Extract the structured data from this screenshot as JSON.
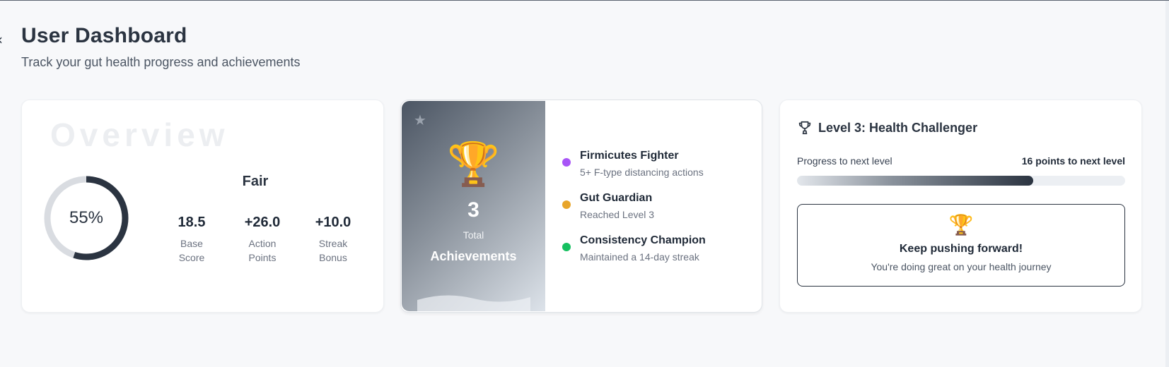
{
  "header": {
    "title": "User Dashboard",
    "subtitle": "Track your gut health progress and achievements"
  },
  "overview": {
    "watermark": "Overview",
    "score_percent": 55,
    "score_label": "55%",
    "status": "Fair",
    "stats": [
      {
        "value": "18.5",
        "label": "Base Score"
      },
      {
        "value": "+26.0",
        "label": "Action Points"
      },
      {
        "value": "+10.0",
        "label": "Streak Bonus"
      }
    ]
  },
  "achievements": {
    "count": "3",
    "total_label": "Total",
    "title": "Achievements",
    "items": [
      {
        "name": "Firmicutes Fighter",
        "description": "5+ F-type distancing actions",
        "color": "#a855f7"
      },
      {
        "name": "Gut Guardian",
        "description": "Reached Level 3",
        "color": "#e8a52a"
      },
      {
        "name": "Consistency Champion",
        "description": "Maintained a 14-day streak",
        "color": "#16c060"
      }
    ]
  },
  "level": {
    "title": "Level 3: Health Challenger",
    "progress_label": "Progress to next level",
    "points_label": "16 points to next level",
    "progress_fraction": 0.72,
    "message_title": "Keep pushing forward!",
    "message_subtitle": "You're doing great on your health journey"
  },
  "icons": {
    "trophy": "trophy-icon",
    "star": "star-icon"
  },
  "colors": {
    "ring": "#2b3441",
    "ring_track": "#d9dce1"
  }
}
